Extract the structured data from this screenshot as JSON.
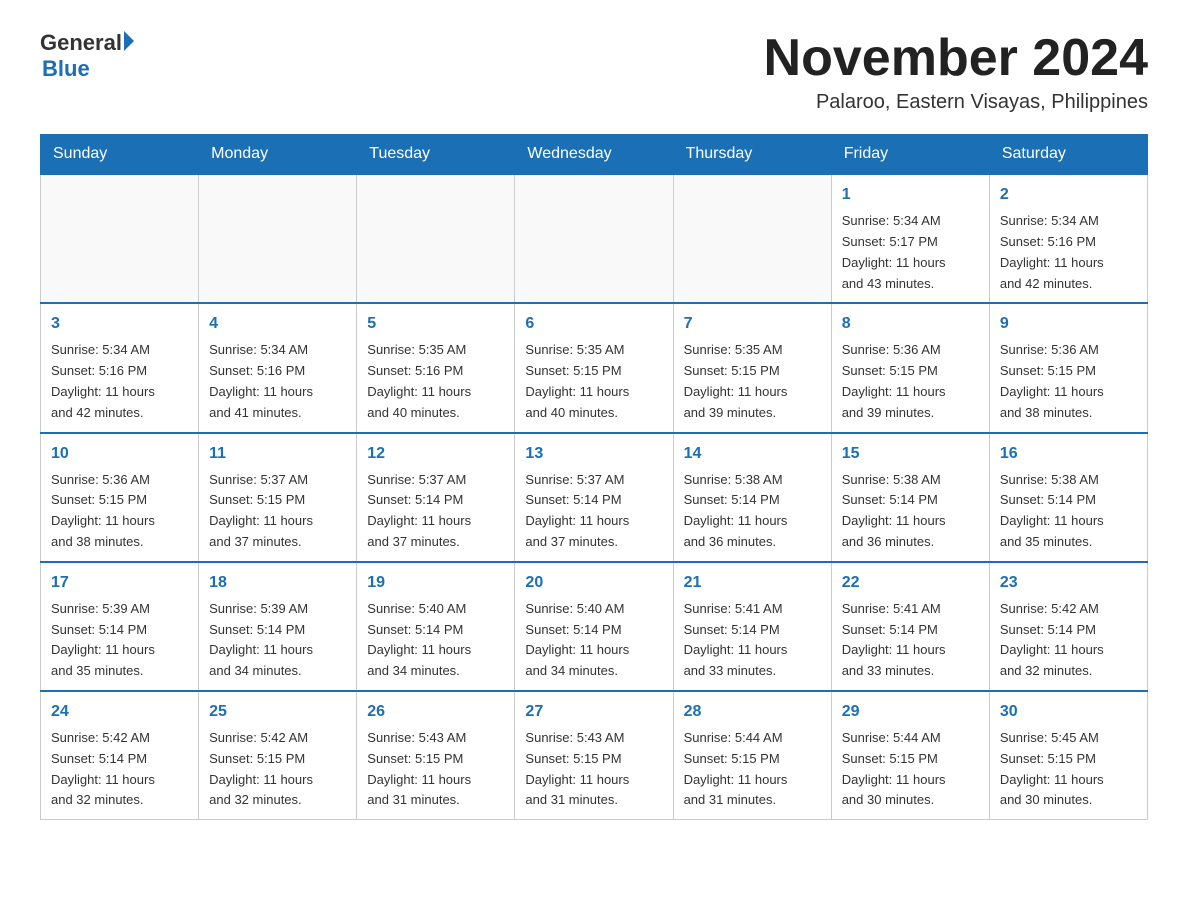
{
  "header": {
    "logo_general": "General",
    "logo_blue": "Blue",
    "month_title": "November 2024",
    "location": "Palaroo, Eastern Visayas, Philippines"
  },
  "days_of_week": [
    "Sunday",
    "Monday",
    "Tuesday",
    "Wednesday",
    "Thursday",
    "Friday",
    "Saturday"
  ],
  "weeks": [
    [
      {
        "day": "",
        "info": ""
      },
      {
        "day": "",
        "info": ""
      },
      {
        "day": "",
        "info": ""
      },
      {
        "day": "",
        "info": ""
      },
      {
        "day": "",
        "info": ""
      },
      {
        "day": "1",
        "info": "Sunrise: 5:34 AM\nSunset: 5:17 PM\nDaylight: 11 hours\nand 43 minutes."
      },
      {
        "day": "2",
        "info": "Sunrise: 5:34 AM\nSunset: 5:16 PM\nDaylight: 11 hours\nand 42 minutes."
      }
    ],
    [
      {
        "day": "3",
        "info": "Sunrise: 5:34 AM\nSunset: 5:16 PM\nDaylight: 11 hours\nand 42 minutes."
      },
      {
        "day": "4",
        "info": "Sunrise: 5:34 AM\nSunset: 5:16 PM\nDaylight: 11 hours\nand 41 minutes."
      },
      {
        "day": "5",
        "info": "Sunrise: 5:35 AM\nSunset: 5:16 PM\nDaylight: 11 hours\nand 40 minutes."
      },
      {
        "day": "6",
        "info": "Sunrise: 5:35 AM\nSunset: 5:15 PM\nDaylight: 11 hours\nand 40 minutes."
      },
      {
        "day": "7",
        "info": "Sunrise: 5:35 AM\nSunset: 5:15 PM\nDaylight: 11 hours\nand 39 minutes."
      },
      {
        "day": "8",
        "info": "Sunrise: 5:36 AM\nSunset: 5:15 PM\nDaylight: 11 hours\nand 39 minutes."
      },
      {
        "day": "9",
        "info": "Sunrise: 5:36 AM\nSunset: 5:15 PM\nDaylight: 11 hours\nand 38 minutes."
      }
    ],
    [
      {
        "day": "10",
        "info": "Sunrise: 5:36 AM\nSunset: 5:15 PM\nDaylight: 11 hours\nand 38 minutes."
      },
      {
        "day": "11",
        "info": "Sunrise: 5:37 AM\nSunset: 5:15 PM\nDaylight: 11 hours\nand 37 minutes."
      },
      {
        "day": "12",
        "info": "Sunrise: 5:37 AM\nSunset: 5:14 PM\nDaylight: 11 hours\nand 37 minutes."
      },
      {
        "day": "13",
        "info": "Sunrise: 5:37 AM\nSunset: 5:14 PM\nDaylight: 11 hours\nand 37 minutes."
      },
      {
        "day": "14",
        "info": "Sunrise: 5:38 AM\nSunset: 5:14 PM\nDaylight: 11 hours\nand 36 minutes."
      },
      {
        "day": "15",
        "info": "Sunrise: 5:38 AM\nSunset: 5:14 PM\nDaylight: 11 hours\nand 36 minutes."
      },
      {
        "day": "16",
        "info": "Sunrise: 5:38 AM\nSunset: 5:14 PM\nDaylight: 11 hours\nand 35 minutes."
      }
    ],
    [
      {
        "day": "17",
        "info": "Sunrise: 5:39 AM\nSunset: 5:14 PM\nDaylight: 11 hours\nand 35 minutes."
      },
      {
        "day": "18",
        "info": "Sunrise: 5:39 AM\nSunset: 5:14 PM\nDaylight: 11 hours\nand 34 minutes."
      },
      {
        "day": "19",
        "info": "Sunrise: 5:40 AM\nSunset: 5:14 PM\nDaylight: 11 hours\nand 34 minutes."
      },
      {
        "day": "20",
        "info": "Sunrise: 5:40 AM\nSunset: 5:14 PM\nDaylight: 11 hours\nand 34 minutes."
      },
      {
        "day": "21",
        "info": "Sunrise: 5:41 AM\nSunset: 5:14 PM\nDaylight: 11 hours\nand 33 minutes."
      },
      {
        "day": "22",
        "info": "Sunrise: 5:41 AM\nSunset: 5:14 PM\nDaylight: 11 hours\nand 33 minutes."
      },
      {
        "day": "23",
        "info": "Sunrise: 5:42 AM\nSunset: 5:14 PM\nDaylight: 11 hours\nand 32 minutes."
      }
    ],
    [
      {
        "day": "24",
        "info": "Sunrise: 5:42 AM\nSunset: 5:14 PM\nDaylight: 11 hours\nand 32 minutes."
      },
      {
        "day": "25",
        "info": "Sunrise: 5:42 AM\nSunset: 5:15 PM\nDaylight: 11 hours\nand 32 minutes."
      },
      {
        "day": "26",
        "info": "Sunrise: 5:43 AM\nSunset: 5:15 PM\nDaylight: 11 hours\nand 31 minutes."
      },
      {
        "day": "27",
        "info": "Sunrise: 5:43 AM\nSunset: 5:15 PM\nDaylight: 11 hours\nand 31 minutes."
      },
      {
        "day": "28",
        "info": "Sunrise: 5:44 AM\nSunset: 5:15 PM\nDaylight: 11 hours\nand 31 minutes."
      },
      {
        "day": "29",
        "info": "Sunrise: 5:44 AM\nSunset: 5:15 PM\nDaylight: 11 hours\nand 30 minutes."
      },
      {
        "day": "30",
        "info": "Sunrise: 5:45 AM\nSunset: 5:15 PM\nDaylight: 11 hours\nand 30 minutes."
      }
    ]
  ]
}
